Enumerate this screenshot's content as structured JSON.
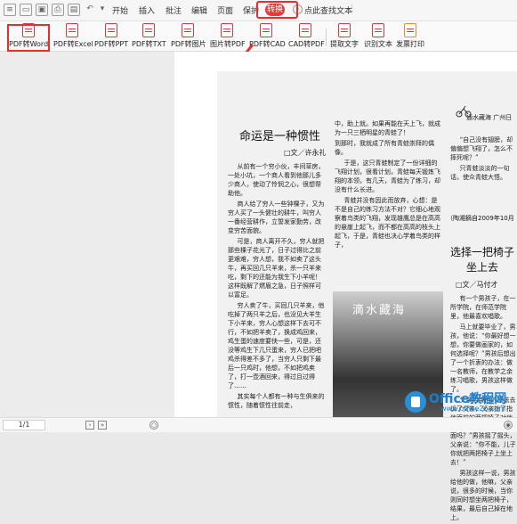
{
  "menubar": {
    "items": [
      "开始",
      "插入",
      "批注",
      "编辑",
      "页面",
      "保护",
      "转换"
    ],
    "active_tab": "转换",
    "search_label": "点此查找文本"
  },
  "ribbon": {
    "tools": [
      {
        "label": "PDF转Word",
        "icon": "pdf-to-word-icon"
      },
      {
        "label": "PDF转Excel",
        "icon": "pdf-to-excel-icon"
      },
      {
        "label": "PDF转PPT",
        "icon": "pdf-to-ppt-icon"
      },
      {
        "label": "PDF转TXT",
        "icon": "pdf-to-txt-icon"
      },
      {
        "label": "PDF转图片",
        "icon": "pdf-to-image-icon"
      },
      {
        "label": "图片转PDF",
        "icon": "image-to-pdf-icon"
      },
      {
        "label": "PDF转CAD",
        "icon": "pdf-to-cad-icon"
      },
      {
        "label": "CAD转PDF",
        "icon": "cad-to-pdf-icon"
      },
      {
        "label": "提取文字",
        "icon": "extract-text-icon"
      },
      {
        "label": "识别文本",
        "icon": "recognize-text-icon"
      },
      {
        "label": "发票打印",
        "icon": "invoice-print-icon"
      }
    ],
    "accent_color": "#e23b3b"
  },
  "document": {
    "left_title": "命运是一种惯性",
    "left_author": "□文／许永礼",
    "left_col1": [
      "从前有一个穷小伙，丰间草房，一处小坑，一个商人看到他那儿多少商人，使动了怜悯之心，很想帮助他。",
      "商人给了穷人一些钟棵子，又为穷人买了一头健壮的耕牛，叫穷人一番经营耕作，立誓发家勤劳，改变穷苦面貌。",
      "可是，商人离开不久，穷人就把那些棵子花光了，日子过得比之前更艰难，穷人想，我不如卖了这头牛，再买回几只羊来，杀一只羊来吃，剩下的还能为我生下小羊呢！这样既解了燃眉之急，日子照样可以富足。",
      "穷人卖了牛，买回几只羊来，他吃掉了两只羊之后，也没见大羊生下小羊来，穷人心想这样下去可不行，不如把羊卖了，换成鸡回来，鸡生蛋的速度要快一些，可是，还没等鸡生下几只蛋来，穷人已把吧鸡杀得差不多了，当穷人只剩下最后一只鸡时，他想，不如把鸡卖了，打一壶酒回来，得过且过得了……",
      "其实每个人都有一种与生俱来的惯性，随着惯性往前走，"
    ],
    "left_col2": [
      "中，助上就。如果再能在天上飞，就成为一只三栖明星的青蛙了！",
      "到那时，我就成了所有青蛙崇拜的偶像。",
      "于是，这只青蛙制定了一份详细的飞翔计划，很看计划，青蛙每天锻炼飞翔的本领，有几天，青蛙为了练习，却没有什么长进。",
      "青蛙并没有因此而放弃，心想：是不是自己的练习方法不对？它细心地观察着鸟类的飞翔，发现雄鹰总是在高高的悬崖上起飞，而不都在高高的枝头上起飞，于是，青蛙也决心学着鸟类的样子，"
    ],
    "right_col": [
      "“自己没有翅膀，却偏偏想飞翔了，怎么不摔死呢？”",
      "只青蛙淡淡的一句话，使众青蛙大悟。"
    ],
    "right_header": "通水藏海",
    "right_header_sub": "广州日",
    "right_source": "（陶湘摘自2009年10月",
    "right_title": "选择一把椅子坐上去",
    "right_author": "□文／马付才",
    "right_col_lower": [
      "有一个男孩子，在一所学院，在师范学院里，他最喜欢唱歌。",
      "马上就要毕业了，男孩，他说：“你最好想一想，你要做画家的，如何选择呢？”男孩后想出了一个折衷的办法：做一名教师，在教学之余练习唱歌，男孩这样做了。",
      "父亲给带他的想法去诉了父亲，父亲指了指他面前的两把椅子对他说：“你可以两把椅子上面吗？”男孩摇了摇头，父亲说：“你不能，儿子你就把两把椅子上坐上去！”",
      "男孩这样一说，男孩给他的做，他嘛，父亲说，很多的时候，当你则同时想坐两把椅子，结果，最后自己掉在地上。"
    ],
    "illustration_title": "滴水藏海"
  },
  "statusbar": {
    "page_indicator": "1/1"
  },
  "watermark": {
    "title": "Office教程网",
    "url": "www.office26.com"
  }
}
